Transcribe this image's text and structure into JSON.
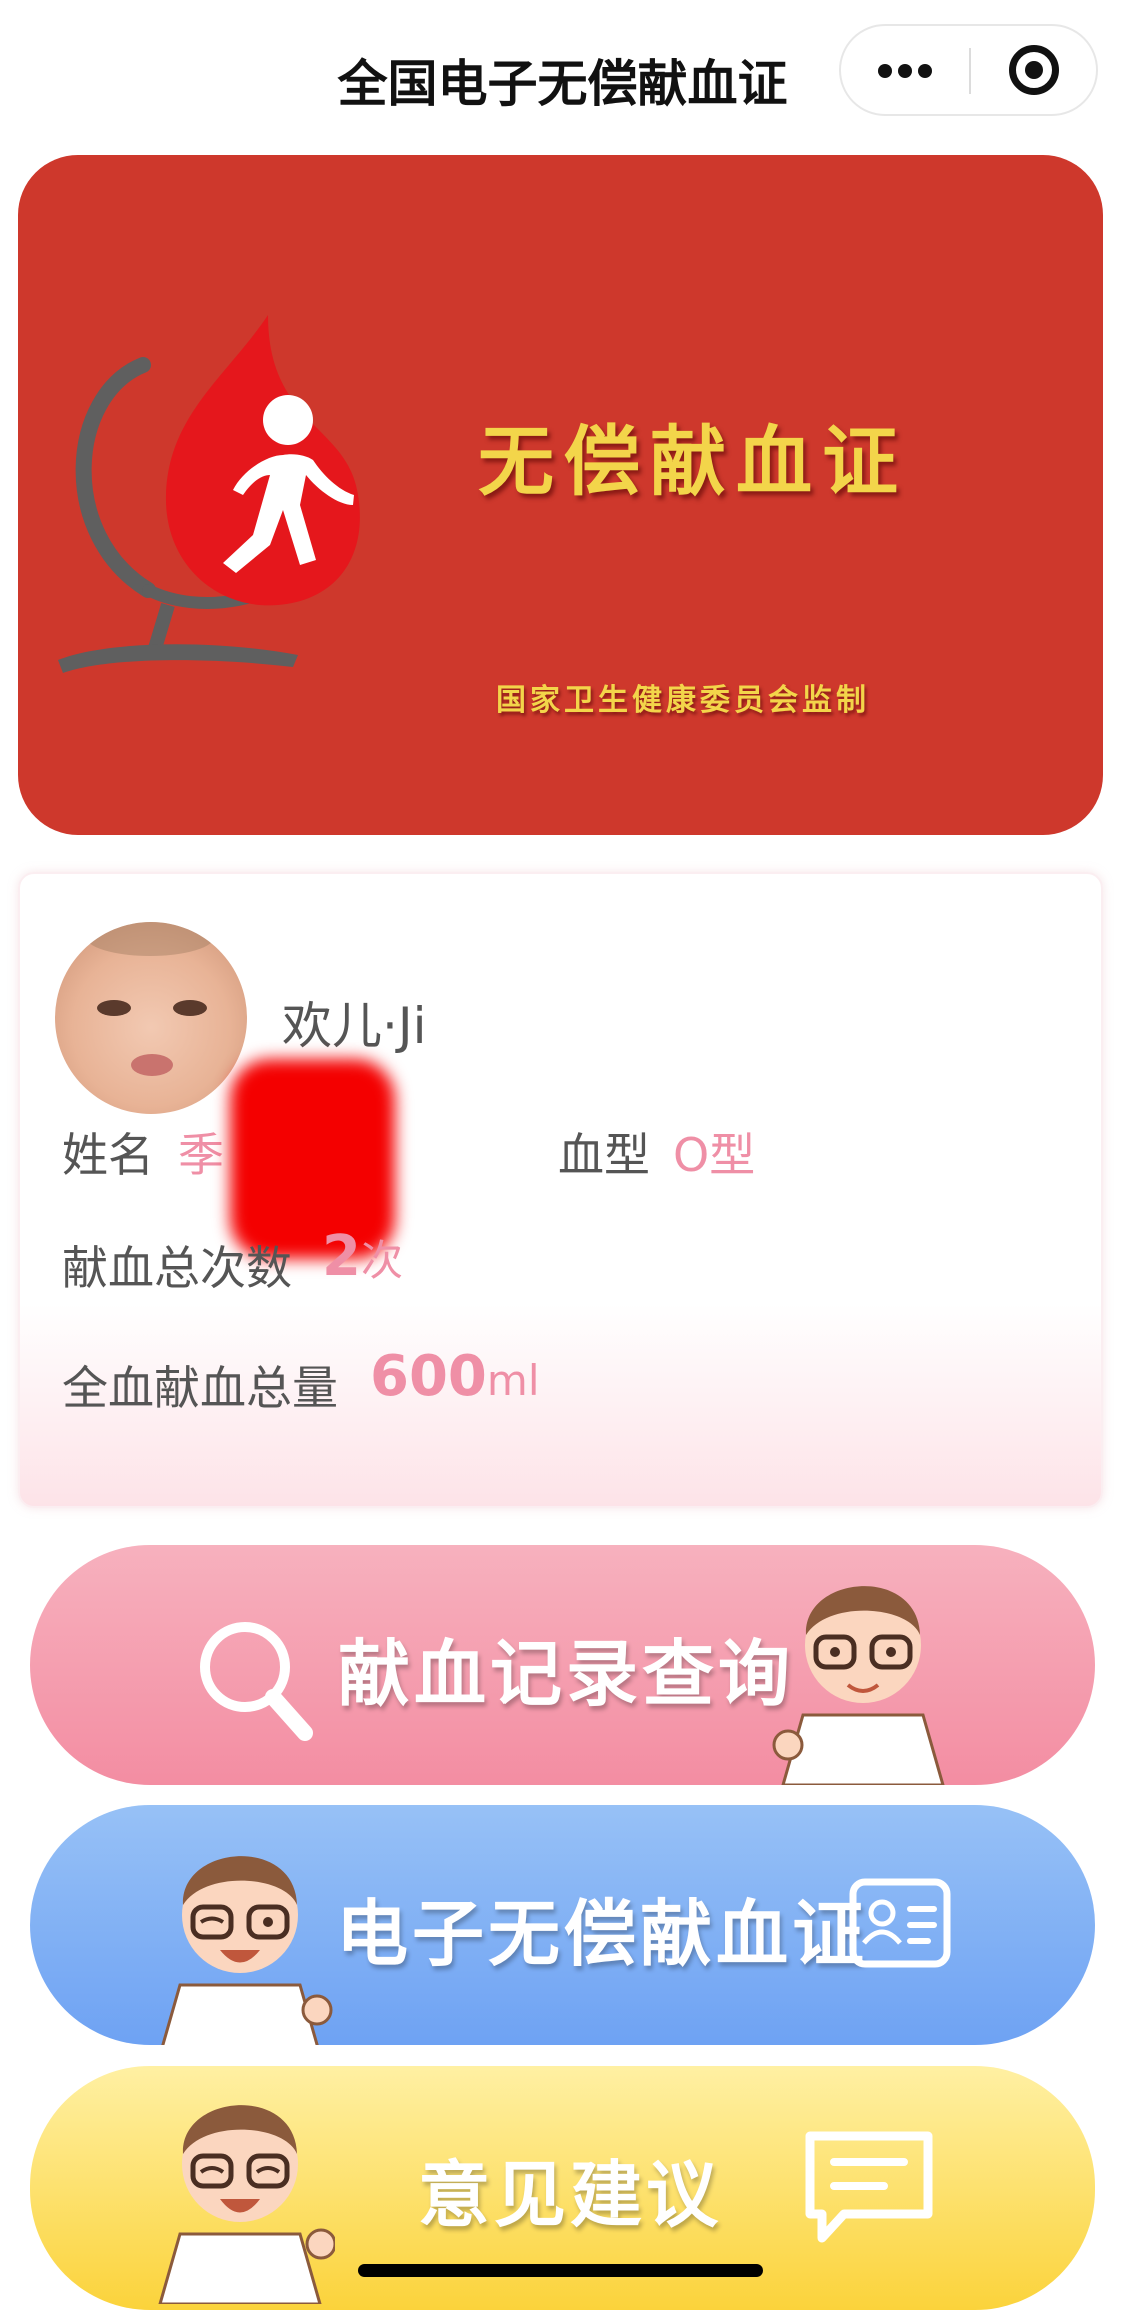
{
  "navbar": {
    "title": "全国电子无偿献血证",
    "more_icon": "more-dots-icon",
    "close_icon": "target-close-icon"
  },
  "certificate": {
    "title": "无偿献血证",
    "issuer": "国家卫生健康委员会监制",
    "background_color": "#ce382c",
    "text_color": "#f3d54a"
  },
  "profile": {
    "nickname": "欢儿·Ji",
    "name_label": "姓名",
    "name_value": "季",
    "blood_type_label": "血型",
    "blood_type_value": "O型",
    "donation_count_label": "献血总次数",
    "donation_count_value": "2",
    "donation_count_unit": "次",
    "total_volume_label": "全血献血总量",
    "total_volume_value": "600",
    "total_volume_unit": "ml",
    "accent_color": "#ef8fa6"
  },
  "actions": {
    "query_label": "献血记录查询",
    "certificate_label": "电子无偿献血证",
    "feedback_label": "意见建议"
  }
}
